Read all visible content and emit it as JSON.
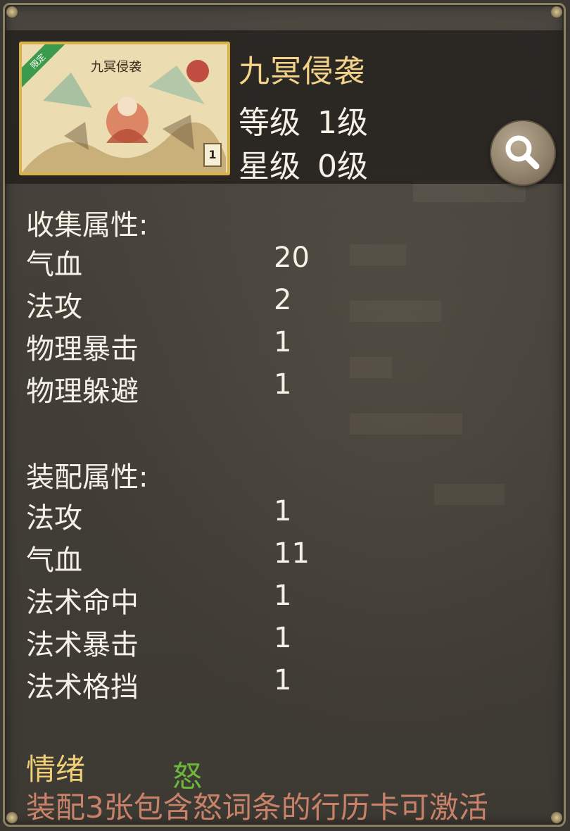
{
  "card": {
    "name": "九冥侵袭",
    "level_label": "等级",
    "level_value": "1级",
    "star_label": "星级",
    "star_value": "0级",
    "art_title": "九冥侵袭",
    "ribbon": "限定",
    "number": "1"
  },
  "collection": {
    "title": "收集属性:",
    "stats": [
      {
        "label": "气血",
        "value": "20"
      },
      {
        "label": "法攻",
        "value": "2"
      },
      {
        "label": "物理暴击",
        "value": "1"
      },
      {
        "label": "物理躲避",
        "value": "1"
      }
    ]
  },
  "equip": {
    "title": "装配属性:",
    "stats": [
      {
        "label": "法攻",
        "value": "1"
      },
      {
        "label": "气血",
        "value": "11"
      },
      {
        "label": "法术命中",
        "value": "1"
      },
      {
        "label": "法术暴击",
        "value": "1"
      },
      {
        "label": "法术格挡",
        "value": "1"
      }
    ]
  },
  "emotion": {
    "title": "情绪",
    "tag": "怒",
    "activate_text": "装配3张包含怒词条的行历卡可激活"
  },
  "colors": {
    "name": "#f3d38a",
    "text": "#f6f1e6",
    "emotion_title": "#f1cf77",
    "emotion_tag": "#6bb83a",
    "activate": "#c9826a"
  },
  "icons": {
    "search": "magnifier-icon"
  }
}
